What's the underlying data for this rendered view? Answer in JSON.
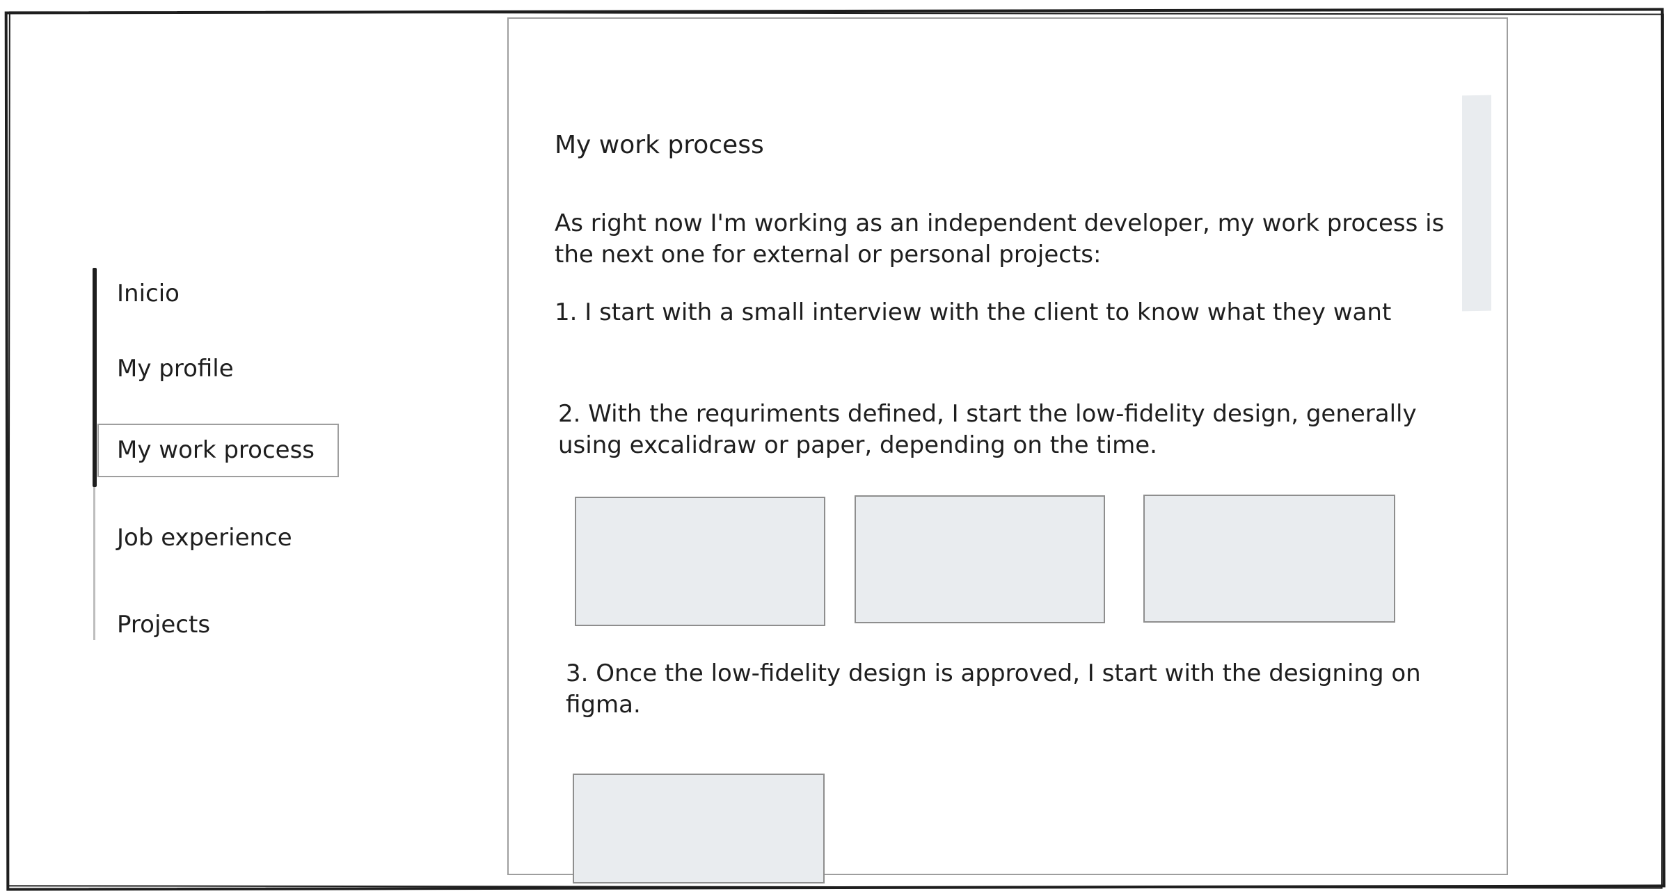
{
  "nav": {
    "items": [
      {
        "label": "Inicio"
      },
      {
        "label": "My profile"
      },
      {
        "label": "My work process"
      },
      {
        "label": "Job experience"
      },
      {
        "label": "Projects"
      }
    ],
    "active_index": 2
  },
  "main": {
    "title": "My work process",
    "intro": "As right now I'm working as an independent developer, my work process is the next one for external or personal projects:",
    "steps": [
      {
        "text": "1. I start with a small interview with the client to know what they want"
      },
      {
        "text": "2. With the requriments defined, I start the low-fidelity design, generally using excalidraw or paper, depending on the time."
      },
      {
        "text": "3. Once the low-fidelity design is approved, I start with the designing on figma."
      }
    ]
  },
  "colors": {
    "ink": "#1e1e1e",
    "placeholder_fill": "#e9ecef",
    "muted_border": "#9e9e9e"
  }
}
